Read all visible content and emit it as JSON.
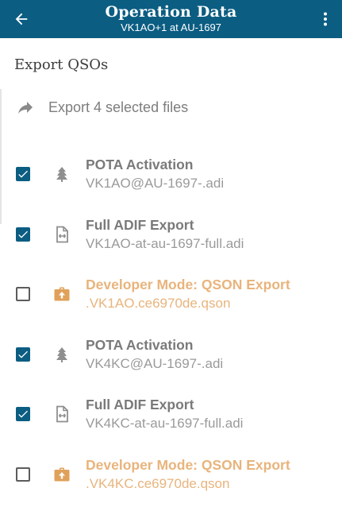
{
  "appbar": {
    "title": "Operation Data",
    "subtitle": "VK1AO+1 at AU-1697",
    "background": "#0b5d82"
  },
  "section": {
    "heading": "Export QSOs"
  },
  "export_action": {
    "label": "Export 4 selected files",
    "icon": "share-arrow-icon"
  },
  "files": [
    {
      "title": "POTA Activation",
      "filename": "VK1AO@AU-1697-.adi",
      "checked": true,
      "icon": "tree-icon",
      "variant": "normal"
    },
    {
      "title": "Full ADIF Export",
      "filename": "VK1AO-at-au-1697-full.adi",
      "checked": true,
      "icon": "file-export-icon",
      "variant": "normal"
    },
    {
      "title": "Developer Mode: QSON Export",
      "filename": ".VK1AO.ce6970de.qson",
      "checked": false,
      "icon": "briefcase-upload-icon",
      "variant": "dev"
    },
    {
      "title": "POTA Activation",
      "filename": "VK4KC@AU-1697-.adi",
      "checked": true,
      "icon": "tree-icon",
      "variant": "normal"
    },
    {
      "title": "Full ADIF Export",
      "filename": "VK4KC-at-au-1697-full.adi",
      "checked": true,
      "icon": "file-export-icon",
      "variant": "normal"
    },
    {
      "title": "Developer Mode: QSON Export",
      "filename": ".VK4KC.ce6970de.qson",
      "checked": false,
      "icon": "briefcase-upload-icon",
      "variant": "dev"
    }
  ],
  "colors": {
    "checkbox_on": "#0b5d82",
    "normal_title": "#7a7a7a",
    "normal_filename": "#9a9a9a",
    "normal_icon": "#8f8f8f",
    "dev_text": "#e8b47c",
    "dev_icon": "#e0a15a"
  }
}
